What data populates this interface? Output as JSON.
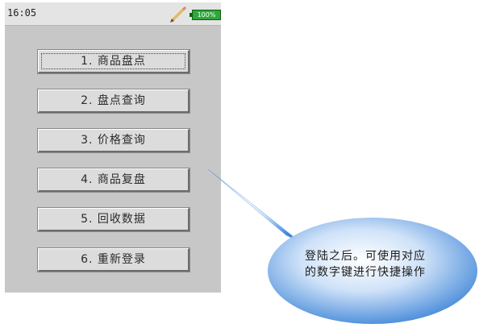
{
  "status_bar": {
    "time": "16:05",
    "battery": "100%",
    "icons": [
      "pencil-icon",
      "battery-icon"
    ]
  },
  "menu": {
    "selected_index": 0,
    "items": [
      {
        "label": "1. 商品盘点"
      },
      {
        "label": "2. 盘点查询"
      },
      {
        "label": "3. 价格查询"
      },
      {
        "label": "4. 商品复盘"
      },
      {
        "label": "5. 回收数据"
      },
      {
        "label": "6. 重新登录"
      }
    ]
  },
  "callout": {
    "text": "登陆之后。可使用对应的数字键进行快捷操作"
  },
  "colors": {
    "screen_bg": "#c7c7c7",
    "status_bar_bg": "#e4e4e4",
    "button_face": "#dcdcdc",
    "battery_fill": "#2ea83a",
    "callout_blue": "#5b9be0"
  }
}
